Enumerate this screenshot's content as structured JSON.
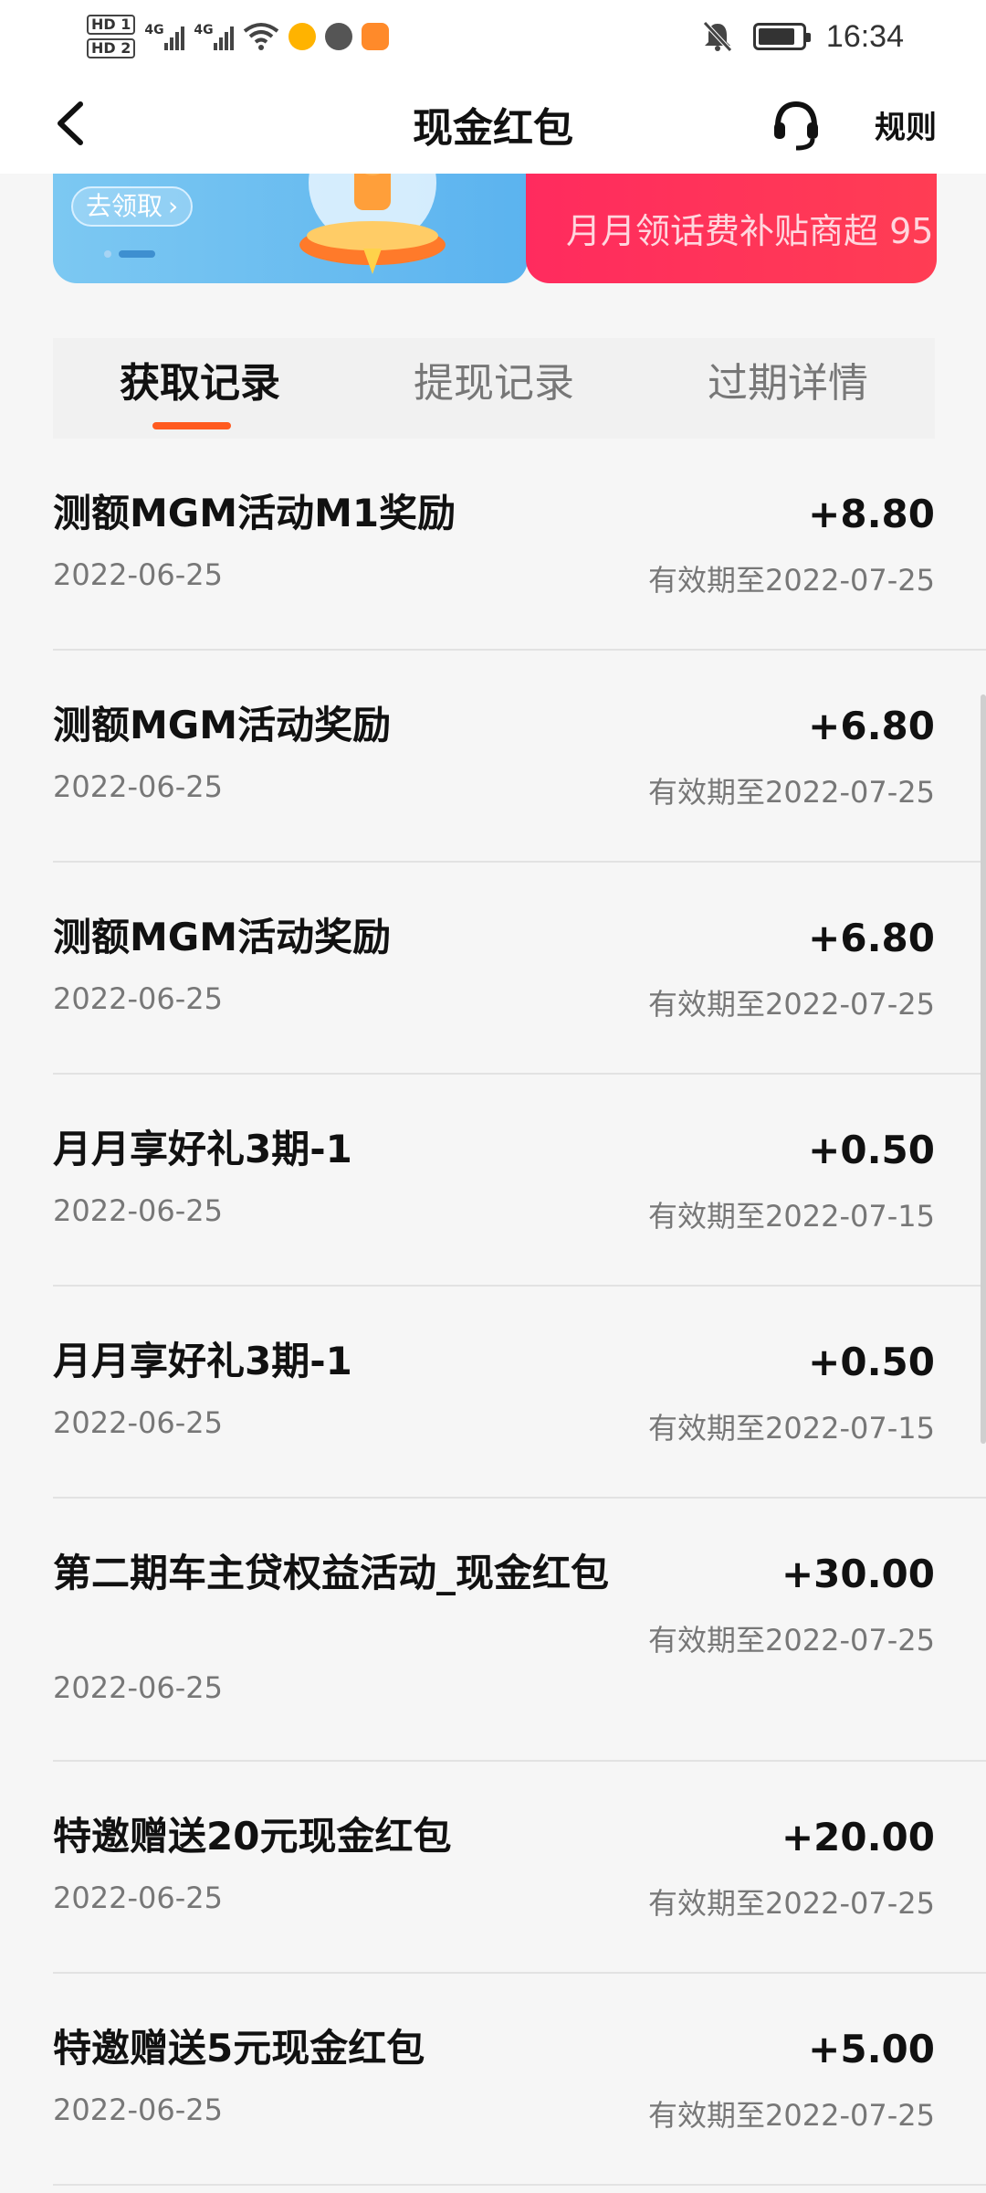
{
  "status_bar": {
    "network_badges": [
      "HD 1",
      "HD 2"
    ],
    "signal_labels": [
      "4G",
      "4G"
    ],
    "time": "16:34",
    "battery_level": 0.86,
    "icons": [
      "wifi-icon",
      "app-icon-cartoon",
      "app-icon-ball",
      "app-icon-play",
      "bell-muted-icon",
      "battery-icon"
    ]
  },
  "nav": {
    "back_icon": "chevron-left-icon",
    "title": "现金红包",
    "support_icon": "headset-icon",
    "rules_label": "规则"
  },
  "banner": {
    "claim_label": "去领取",
    "promo_text": "月月领话费补贴商超 95",
    "colors": {
      "left": "#5bb3ef",
      "right": "#ff2b5e"
    }
  },
  "tabs": [
    {
      "label": "获取记录",
      "active": true
    },
    {
      "label": "提现记录",
      "active": false
    },
    {
      "label": "过期详情",
      "active": false
    }
  ],
  "accent_color": "#ff5a1f",
  "records": [
    {
      "title": "测额MGM活动M1奖励",
      "date": "2022-06-25",
      "amount": "+8.80",
      "expiry": "有效期至2022-07-25"
    },
    {
      "title": "测额MGM活动奖励",
      "date": "2022-06-25",
      "amount": "+6.80",
      "expiry": "有效期至2022-07-25"
    },
    {
      "title": "测额MGM活动奖励",
      "date": "2022-06-25",
      "amount": "+6.80",
      "expiry": "有效期至2022-07-25"
    },
    {
      "title": "月月享好礼3期-1",
      "date": "2022-06-25",
      "amount": "+0.50",
      "expiry": "有效期至2022-07-15"
    },
    {
      "title": "月月享好礼3期-1",
      "date": "2022-06-25",
      "amount": "+0.50",
      "expiry": "有效期至2022-07-15"
    },
    {
      "title": "第二期车主贷权益活动_现金红包",
      "date": "2022-06-25",
      "amount": "+30.00",
      "expiry": "有效期至2022-07-25"
    },
    {
      "title": "特邀赠送20元现金红包",
      "date": "2022-06-25",
      "amount": "+20.00",
      "expiry": "有效期至2022-07-25"
    },
    {
      "title": "特邀赠送5元现金红包",
      "date": "2022-06-25",
      "amount": "+5.00",
      "expiry": "有效期至2022-07-25"
    }
  ]
}
